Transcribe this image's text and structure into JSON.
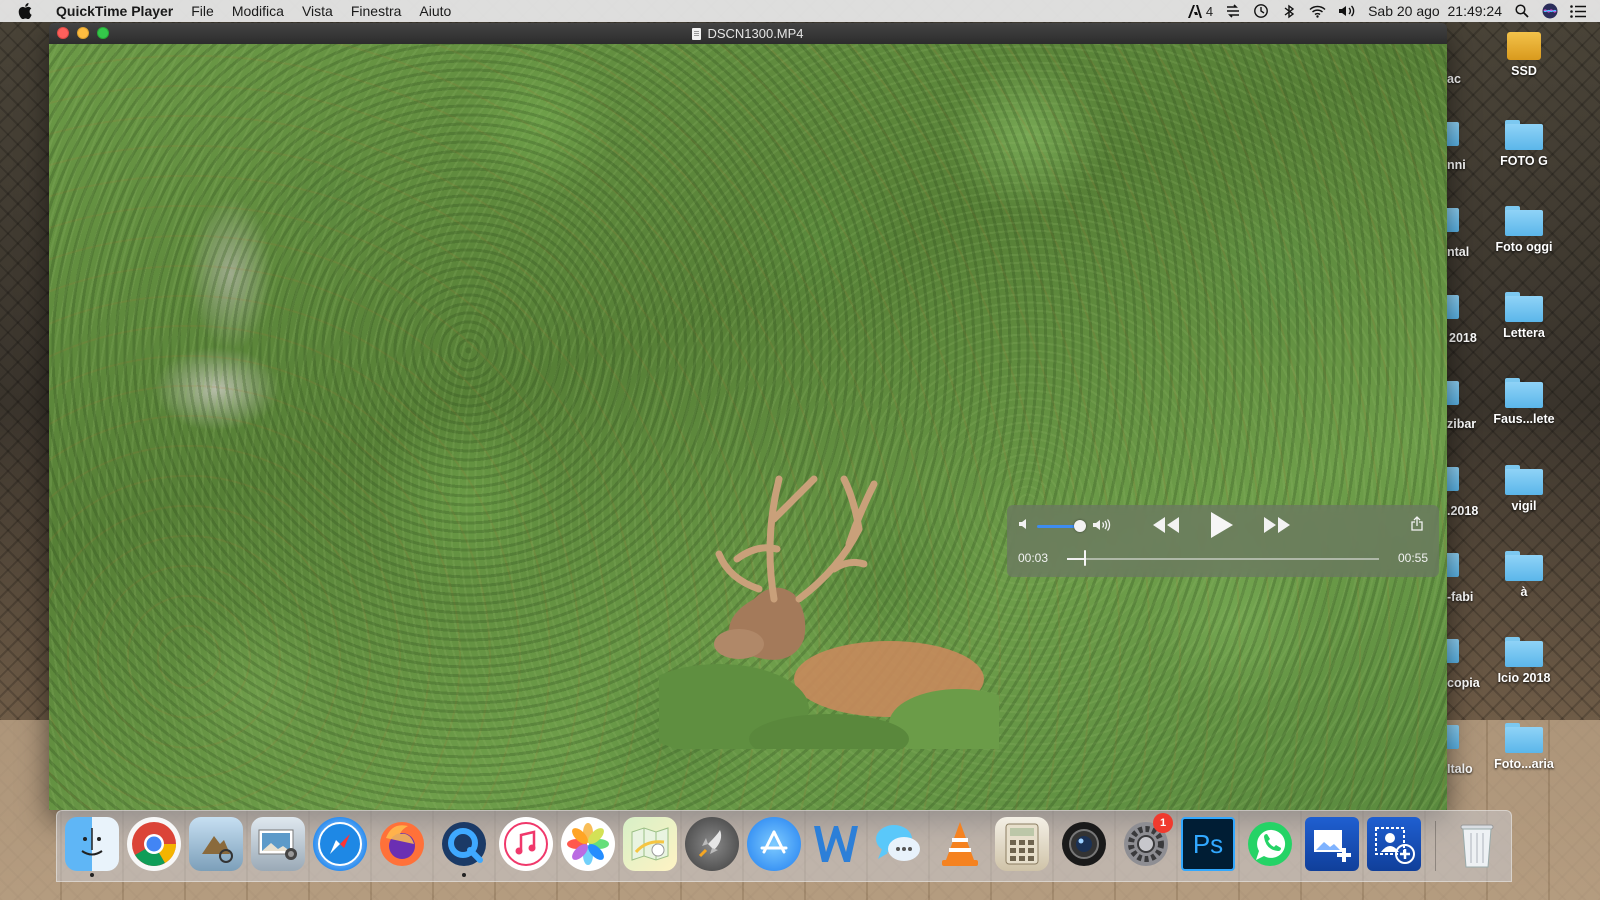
{
  "menubar": {
    "app_name": "QuickTime Player",
    "items": [
      "File",
      "Modifica",
      "Vista",
      "Finestra",
      "Aiuto"
    ],
    "status": {
      "adobe_count": "4",
      "datetime": "Sab 20 ago  21:49:24"
    }
  },
  "window": {
    "title": "DSCN1300.MP4"
  },
  "player": {
    "current_time": "00:03",
    "total_time": "00:55",
    "volume_fraction": 0.85,
    "progress_fraction": 0.055
  },
  "desktop": {
    "icons": [
      {
        "label": "SSD",
        "type": "drive"
      },
      {
        "label": "FOTO G",
        "type": "folder"
      },
      {
        "label": "Foto oggi",
        "type": "folder"
      },
      {
        "label": "Lettera",
        "type": "folder"
      },
      {
        "label": "Faus...lete",
        "type": "folder"
      },
      {
        "label": "vigil",
        "type": "folder"
      },
      {
        "label": "à",
        "type": "folder"
      },
      {
        "label": "Icio 2018",
        "type": "folder"
      },
      {
        "label": "Foto...aria",
        "type": "folder"
      }
    ],
    "partial_labels": [
      "ac",
      "nni",
      "ntal",
      "2018",
      "zibar",
      ".2018",
      "-fabi",
      "copia",
      "Italo"
    ]
  },
  "dock": {
    "apps": [
      {
        "name": "Finder",
        "icon": "finder-icon"
      },
      {
        "name": "Chrome",
        "icon": "chrome-icon"
      },
      {
        "name": "Preview Eagle",
        "icon": "preview-icon"
      },
      {
        "name": "Image Capture",
        "icon": "image-capture-icon"
      },
      {
        "name": "Safari",
        "icon": "safari-icon"
      },
      {
        "name": "Firefox",
        "icon": "firefox-icon"
      },
      {
        "name": "QuickTime Player",
        "icon": "quicktime-icon"
      },
      {
        "name": "iTunes",
        "icon": "itunes-icon"
      },
      {
        "name": "Photos",
        "icon": "photos-icon"
      },
      {
        "name": "Maps",
        "icon": "maps-icon"
      },
      {
        "name": "Launchpad",
        "icon": "launchpad-icon"
      },
      {
        "name": "App Store",
        "icon": "app-store-icon"
      },
      {
        "name": "Word",
        "icon": "word-icon"
      },
      {
        "name": "Messages",
        "icon": "messages-icon"
      },
      {
        "name": "VLC",
        "icon": "vlc-icon"
      },
      {
        "name": "Calculator",
        "icon": "calculator-icon"
      },
      {
        "name": "Photo Booth",
        "icon": "photo-booth-icon"
      },
      {
        "name": "System Preferences",
        "icon": "system-preferences-icon",
        "badge": "1"
      },
      {
        "name": "Photoshop",
        "icon": "photoshop-icon",
        "label": "Ps"
      },
      {
        "name": "WhatsApp",
        "icon": "whatsapp-icon"
      },
      {
        "name": "Image Editor",
        "icon": "image-editor-icon"
      },
      {
        "name": "Contact Add",
        "icon": "contact-add-icon"
      },
      {
        "name": "Trash",
        "icon": "trash-icon"
      }
    ]
  }
}
